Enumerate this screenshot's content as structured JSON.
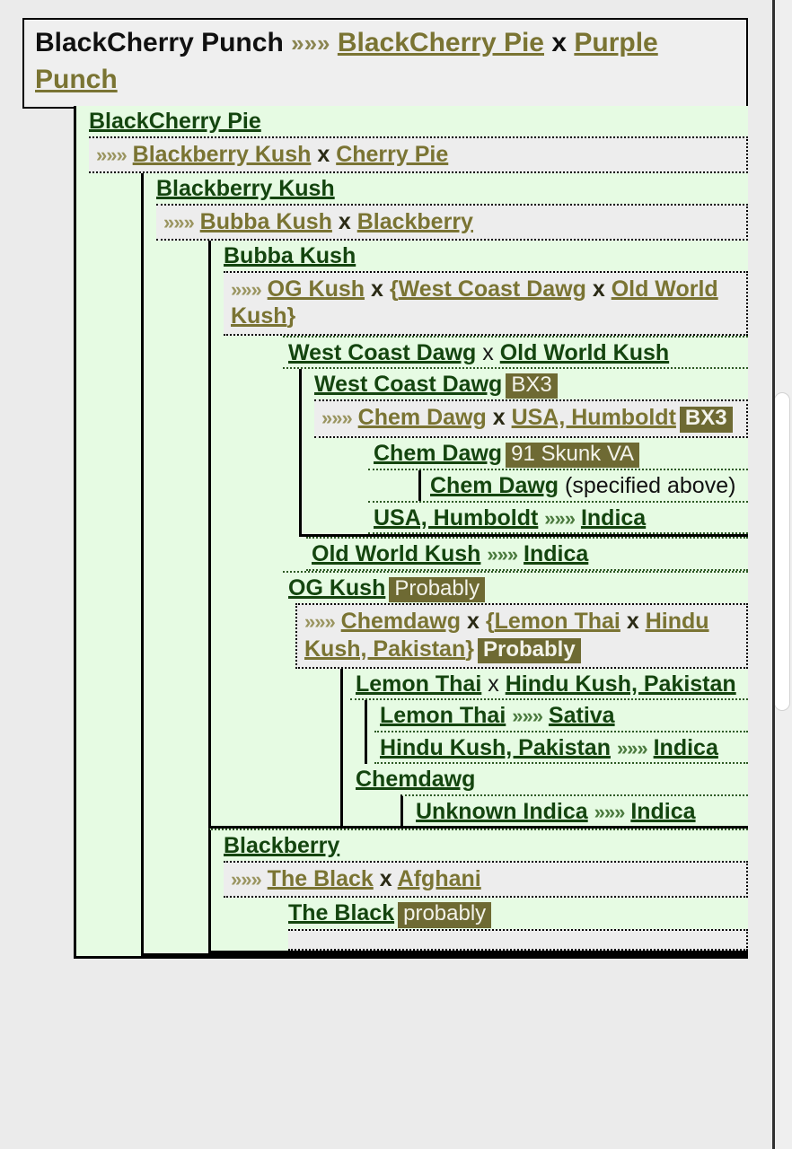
{
  "header": {
    "strain": "BlackCherry Punch",
    "chev": "»»»",
    "parent_a": "BlackCherry Pie",
    "x": "x",
    "parent_b": "Purple Punch"
  },
  "symbols": {
    "chev": "»»»",
    "x": "x",
    "open_brace": "{",
    "close_brace": "}"
  },
  "colors": {
    "page_bg": "#ebebeb",
    "node_bg": "#e6fbe3",
    "cross_bg": "#ededed",
    "title_green": "#14450f",
    "link_olive": "#7a7433",
    "badge_bg": "#6e6a33",
    "badge_fg": "#f3f3ea",
    "border_black": "#000000"
  },
  "nodes": {
    "blackcherry_pie": {
      "title": "BlackCherry Pie",
      "cross": {
        "a": "Blackberry Kush",
        "b": "Cherry Pie"
      }
    },
    "blackberry_kush": {
      "title": "Blackberry Kush",
      "cross": {
        "a": "Bubba Kush",
        "b": "Blackberry"
      }
    },
    "bubba_kush": {
      "title": "Bubba Kush",
      "cross": {
        "a": "OG Kush",
        "b1": "West Coast Dawg",
        "b2": "Old World Kush"
      }
    },
    "wcd_owk": {
      "title_a": "West Coast Dawg",
      "title_b": "Old World Kush"
    },
    "west_coast_dawg": {
      "title": "West Coast Dawg",
      "badge": "BX3",
      "cross": {
        "a": "Chem Dawg",
        "b": "USA, Humboldt",
        "badge": "BX3"
      }
    },
    "chem_dawg": {
      "title": "Chem Dawg",
      "badge": "91 Skunk VA"
    },
    "chem_dawg_ref": {
      "title": "Chem Dawg",
      "note": "(specified above)"
    },
    "usa_humboldt": {
      "title": "USA, Humboldt",
      "result": "Indica"
    },
    "old_world_kush": {
      "title": "Old World Kush",
      "result": "Indica"
    },
    "og_kush": {
      "title": "OG Kush",
      "badge": "Probably",
      "cross": {
        "a": "Chemdawg",
        "b1": "Lemon Thai",
        "b2": "Hindu Kush, Pakistan",
        "badge": "Probably"
      }
    },
    "lemonthai_hindukush": {
      "title_a": "Lemon Thai",
      "title_b": "Hindu Kush, Pakistan"
    },
    "lemon_thai": {
      "title": "Lemon Thai",
      "result": "Sativa"
    },
    "hindu_kush": {
      "title": "Hindu Kush, Pakistan",
      "result": "Indica"
    },
    "chemdawg": {
      "title": "Chemdawg"
    },
    "unknown_indica": {
      "title": "Unknown Indica",
      "result": "Indica"
    },
    "blackberry": {
      "title": "Blackberry",
      "cross": {
        "a": "The Black",
        "b": "Afghani"
      }
    },
    "the_black": {
      "title": "The Black",
      "badge": "probably"
    }
  },
  "scrollbar": {
    "name": "vertical-scrollbar"
  }
}
